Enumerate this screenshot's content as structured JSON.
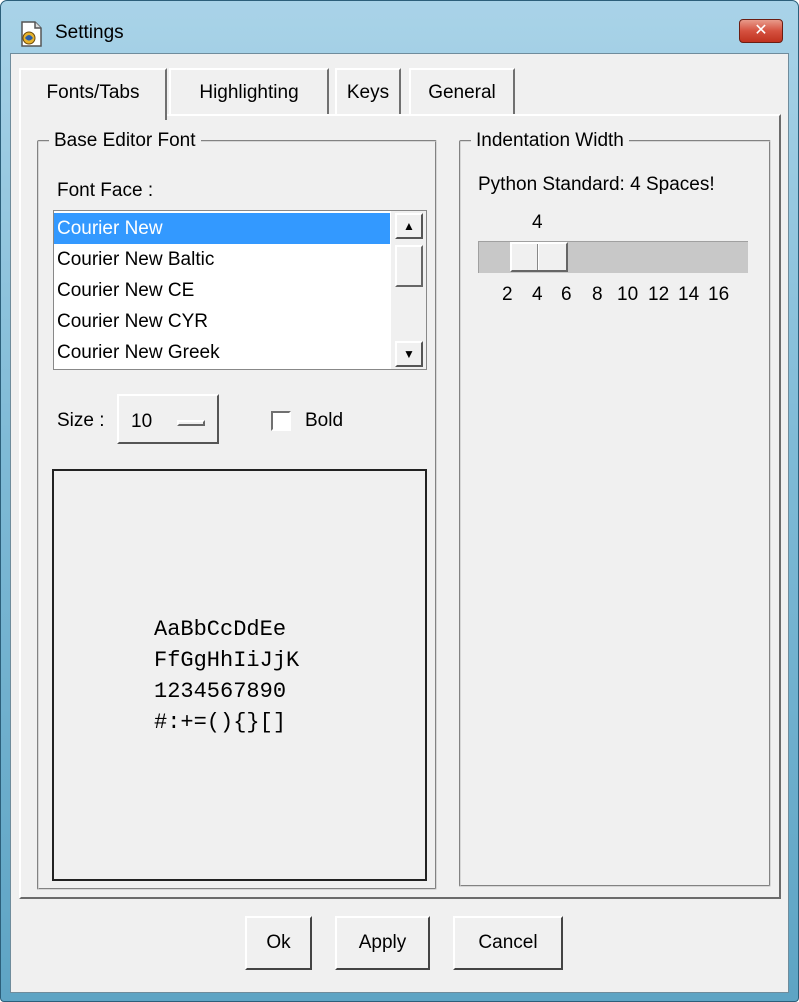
{
  "window": {
    "title": "Settings",
    "close_glyph": "✕",
    "icon": "idle-app-icon",
    "close_color": "#c73a26"
  },
  "tabs": [
    {
      "label": "Fonts/Tabs",
      "selected": true
    },
    {
      "label": "Highlighting",
      "selected": false
    },
    {
      "label": "Keys",
      "selected": false
    },
    {
      "label": "General",
      "selected": false
    }
  ],
  "font_group": {
    "title": "Base Editor Font",
    "font_face_label": "Font Face :",
    "font_list": [
      {
        "label": "Courier New",
        "selected": true
      },
      {
        "label": "Courier New Baltic",
        "selected": false
      },
      {
        "label": "Courier New CE",
        "selected": false
      },
      {
        "label": "Courier New CYR",
        "selected": false
      },
      {
        "label": "Courier New Greek",
        "selected": false
      }
    ],
    "size_label": "Size :",
    "size_value": "10",
    "bold_label": "Bold",
    "bold_checked": false,
    "selection_color": "#3399ff",
    "preview_lines": [
      "AaBbCcDdEe",
      "FfGgHhIiJjK",
      "1234567890",
      "#:+=(){}[]"
    ]
  },
  "indent_group": {
    "title": "Indentation Width",
    "note": "Python Standard: 4 Spaces!",
    "scale_value": "4",
    "tick_labels": [
      "2",
      "4",
      "6",
      "8",
      "10",
      "12",
      "14",
      "16"
    ]
  },
  "buttons": {
    "ok": "Ok",
    "apply": "Apply",
    "cancel": "Cancel"
  }
}
